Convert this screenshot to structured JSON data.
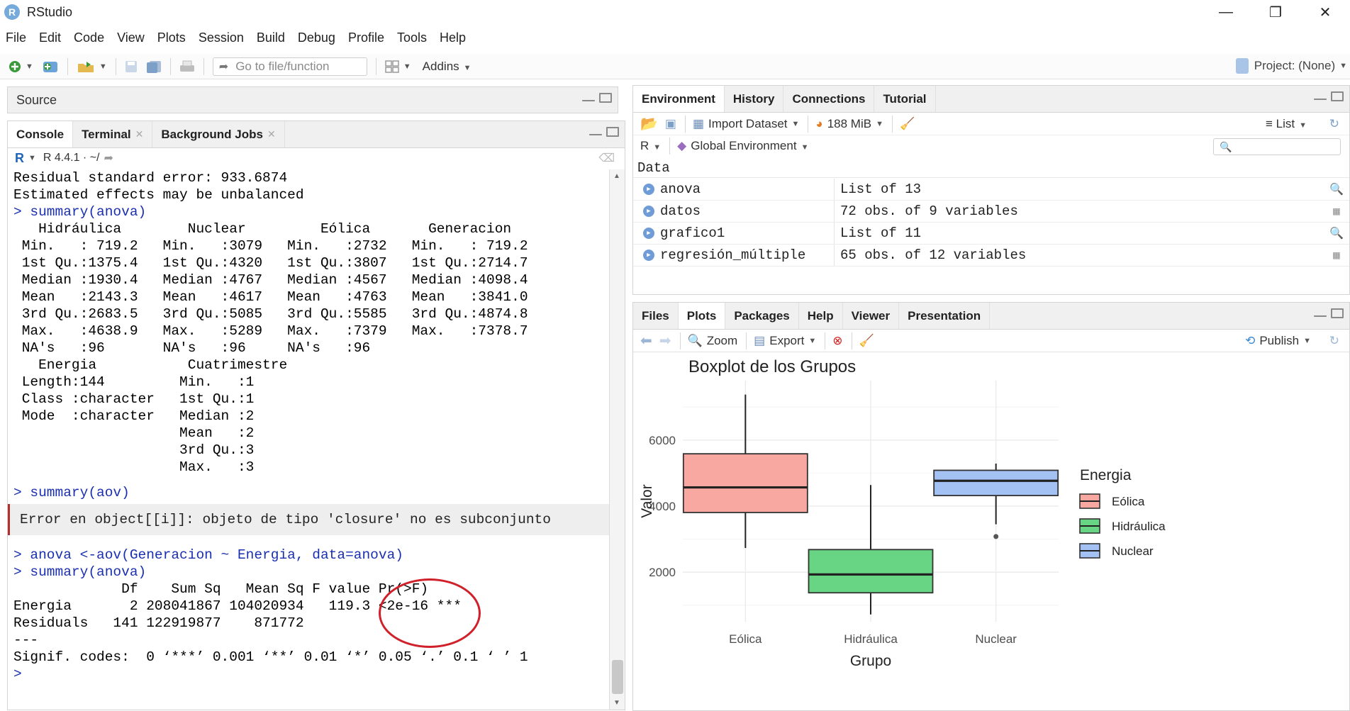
{
  "window": {
    "title": "RStudio",
    "minimize": "—",
    "maximize": "❐",
    "close": "✕"
  },
  "menu": [
    "File",
    "Edit",
    "Code",
    "View",
    "Plots",
    "Session",
    "Build",
    "Debug",
    "Profile",
    "Tools",
    "Help"
  ],
  "toolbar": {
    "goto_placeholder": "Go to file/function",
    "addins": "Addins",
    "project": "Project: (None)"
  },
  "source_pane": {
    "label": "Source"
  },
  "console_pane": {
    "tabs": [
      "Console",
      "Terminal",
      "Background Jobs"
    ],
    "r_version": "R 4.4.1 · ~/",
    "lines": [
      {
        "t": "Residual standard error: 933.6874",
        "k": "out"
      },
      {
        "t": "Estimated effects may be unbalanced",
        "k": "out"
      },
      {
        "t": "> summary(anova)",
        "k": "in"
      },
      {
        "t": "   Hidráulica        Nuclear         Eólica       Generacion    ",
        "k": "out"
      },
      {
        "t": " Min.   : 719.2   Min.   :3079   Min.   :2732   Min.   : 719.2  ",
        "k": "out"
      },
      {
        "t": " 1st Qu.:1375.4   1st Qu.:4320   1st Qu.:3807   1st Qu.:2714.7  ",
        "k": "out"
      },
      {
        "t": " Median :1930.4   Median :4767   Median :4567   Median :4098.4  ",
        "k": "out"
      },
      {
        "t": " Mean   :2143.3   Mean   :4617   Mean   :4763   Mean   :3841.0  ",
        "k": "out"
      },
      {
        "t": " 3rd Qu.:2683.5   3rd Qu.:5085   3rd Qu.:5585   3rd Qu.:4874.8  ",
        "k": "out"
      },
      {
        "t": " Max.   :4638.9   Max.   :5289   Max.   :7379   Max.   :7378.7  ",
        "k": "out"
      },
      {
        "t": " NA's   :96       NA's   :96     NA's   :96                     ",
        "k": "out"
      },
      {
        "t": "   Energia           Cuatrimestre ",
        "k": "out"
      },
      {
        "t": " Length:144         Min.   :1    ",
        "k": "out"
      },
      {
        "t": " Class :character   1st Qu.:1    ",
        "k": "out"
      },
      {
        "t": " Mode  :character   Median :2    ",
        "k": "out"
      },
      {
        "t": "                    Mean   :2    ",
        "k": "out"
      },
      {
        "t": "                    3rd Qu.:3    ",
        "k": "out"
      },
      {
        "t": "                    Max.   :3    ",
        "k": "out"
      },
      {
        "t": "",
        "k": "blank"
      },
      {
        "t": "> summary(aov)",
        "k": "in"
      },
      {
        "t": "Error en object[[i]]: objeto de tipo 'closure' no es subconjunto",
        "k": "err"
      },
      {
        "t": "",
        "k": "blank"
      },
      {
        "t": "> anova <-aov(Generacion ~ Energia, data=anova)",
        "k": "in"
      },
      {
        "t": "> summary(anova)",
        "k": "in"
      },
      {
        "t": "             Df    Sum Sq   Mean Sq F value Pr(>F)    ",
        "k": "out"
      },
      {
        "t": "Energia       2 208041867 104020934   119.3 <2e-16 ***",
        "k": "out"
      },
      {
        "t": "Residuals   141 122919877    871772                   ",
        "k": "out"
      },
      {
        "t": "---",
        "k": "out"
      },
      {
        "t": "Signif. codes:  0 ‘***’ 0.001 ‘**’ 0.01 ‘*’ 0.05 ‘.’ 0.1 ‘ ’ 1",
        "k": "out"
      },
      {
        "t": ">",
        "k": "in"
      }
    ]
  },
  "env_pane": {
    "tabs": [
      "Environment",
      "History",
      "Connections",
      "Tutorial"
    ],
    "import_dataset": "Import Dataset",
    "memory": "188 MiB",
    "list_view": "List",
    "lang": "R",
    "scope": "Global Environment",
    "section": "Data",
    "rows": [
      {
        "name": "anova",
        "value": "List of  13",
        "icon": "magnifier-icon"
      },
      {
        "name": "datos",
        "value": "72 obs. of 9 variables",
        "icon": "table-icon"
      },
      {
        "name": "grafico1",
        "value": "List of  11",
        "icon": "magnifier-icon"
      },
      {
        "name": "regresión_múltiple",
        "value": "65 obs. of 12 variables",
        "icon": "table-icon"
      }
    ]
  },
  "plots_pane": {
    "tabs": [
      "Files",
      "Plots",
      "Packages",
      "Help",
      "Viewer",
      "Presentation"
    ],
    "zoom": "Zoom",
    "export": "Export",
    "publish": "Publish"
  },
  "chart_data": {
    "type": "boxplot",
    "title": "Boxplot de los Grupos",
    "xlabel": "Grupo",
    "ylabel": "Valor",
    "categories": [
      "Eólica",
      "Hidráulica",
      "Nuclear"
    ],
    "ylim": [
      500,
      7800
    ],
    "yticks": [
      2000,
      4000,
      6000
    ],
    "grid": true,
    "legend": {
      "title": "Energia",
      "placement": "right",
      "items": [
        "Eólica",
        "Hidráulica",
        "Nuclear"
      ]
    },
    "colors": [
      "#f8a7a1",
      "#68d585",
      "#a4c1f4"
    ],
    "boxes": [
      {
        "name": "Eólica",
        "min": 2732,
        "q1": 3807,
        "median": 4567,
        "q3": 5585,
        "max": 7379,
        "outliers": []
      },
      {
        "name": "Hidráulica",
        "min": 719.2,
        "q1": 1375.4,
        "median": 1930.4,
        "q3": 2683.5,
        "max": 4638.9,
        "outliers": []
      },
      {
        "name": "Nuclear",
        "min": 3450,
        "q1": 4320,
        "median": 4767,
        "q3": 5085,
        "max": 5289,
        "outliers": [
          3079
        ]
      }
    ]
  }
}
